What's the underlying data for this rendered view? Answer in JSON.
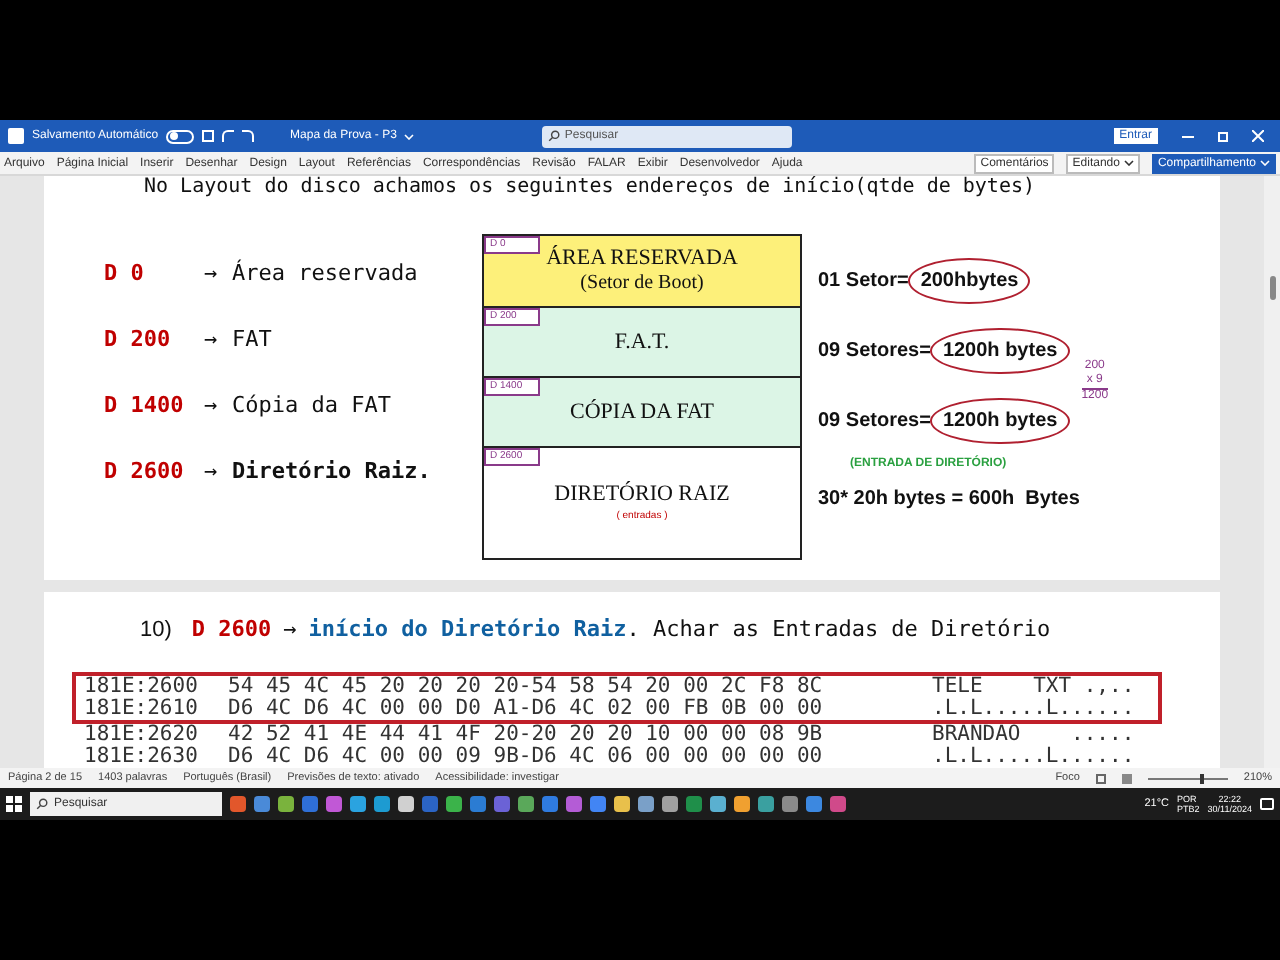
{
  "title_bar": {
    "autosave": {
      "label": "Salvamento Automático",
      "on": false
    },
    "document": "Mapa da Prova - P3",
    "search": {
      "placeholder": "Pesquisar"
    },
    "sign_in": "Entrar"
  },
  "ribbon": {
    "tabs": [
      {
        "label": "Arquivo",
        "selected": false
      },
      {
        "label": "Página Inicial",
        "selected": false
      },
      {
        "label": "Inserir",
        "selected": false
      },
      {
        "label": "Desenhar",
        "selected": false
      },
      {
        "label": "Design",
        "selected": false
      },
      {
        "label": "Layout",
        "selected": false
      },
      {
        "label": "Referências",
        "selected": false
      },
      {
        "label": "Correspondências",
        "selected": false
      },
      {
        "label": "Revisão",
        "selected": false
      },
      {
        "label": "FALAR",
        "selected": false
      },
      {
        "label": "Exibir",
        "selected": false
      },
      {
        "label": "Desenvolvedor",
        "selected": false
      },
      {
        "label": "Ajuda",
        "selected": false
      }
    ],
    "actions": [
      {
        "label": "Comentários",
        "kind": "comments"
      },
      {
        "label": "Editando",
        "kind": "editing"
      },
      {
        "label": "Compartilhamento",
        "kind": "share"
      }
    ]
  },
  "page1": {
    "heading": "No Layout do disco achamos os seguintes endereços de início(qtde de bytes)",
    "layout_list": [
      {
        "address": "D 0",
        "arrow": "→",
        "label": "Área reservada",
        "bold": false
      },
      {
        "address": "D 200",
        "arrow": "→",
        "label": "FAT",
        "bold": false
      },
      {
        "address": "D 1400",
        "arrow": "→",
        "label": "Cópia da FAT",
        "bold": false
      },
      {
        "address": "D 2600",
        "arrow": "→",
        "label": "Diretório Raiz.",
        "bold": true
      }
    ],
    "diagram": {
      "blocks": [
        {
          "tag": "D 0",
          "title": "ÁREA RESERVADA",
          "subtitle": "(Setor de Boot)",
          "color": "#fdf07a"
        },
        {
          "tag": "D 200",
          "title": "F.A.T.",
          "color": "#dcf5e6"
        },
        {
          "tag": "D 1400",
          "title": "CÓPIA DA FAT",
          "color": "#dcf5e6"
        },
        {
          "tag": "D 2600",
          "title": "DIRETÓRIO RAIZ",
          "note": "( entradas )",
          "color": "#ffffff"
        }
      ]
    },
    "notes": [
      {
        "kind": "size",
        "label": "01 Setor=",
        "value": "200hbytes"
      },
      {
        "kind": "size",
        "label": "09 Setores=",
        "value": "1200h bytes",
        "calc": [
          "200",
          "x 9",
          "1200"
        ]
      },
      {
        "kind": "size",
        "label": "09 Setores=",
        "value": "1200h bytes"
      },
      {
        "kind": "caption",
        "text": "(ENTRADA DE DIRETÓRIO)"
      },
      {
        "kind": "formula",
        "text": "30* 20h bytes = 600h  Bytes"
      }
    ]
  },
  "page2": {
    "number": "10)",
    "address": "D 2600",
    "arrow": "→",
    "topic": "início do Diretório Raiz",
    "rest": ". Achar as Entradas de Diretório",
    "dump": [
      {
        "address": "181E:2600",
        "bytes": "54 45 4C 45 20 20 20 20-54 58 54 20 00 2C F8 8C",
        "ascii": "TELE    TXT .,..",
        "highlighted": true
      },
      {
        "address": "181E:2610",
        "bytes": "D6 4C D6 4C 00 00 D0 A1-D6 4C 02 00 FB 0B 00 00",
        "ascii": ".L.L.....L......",
        "highlighted": true
      },
      {
        "address": "181E:2620",
        "bytes": "42 52 41 4E 44 41 4F 20-20 20 20 10 00 00 08 9B",
        "ascii": "BRANDAO    .....",
        "highlighted": false
      },
      {
        "address": "181E:2630",
        "bytes": "D6 4C D6 4C 00 00 09 9B-D6 4C 06 00 00 00 00 00",
        "ascii": ".L.L.....L......",
        "highlighted": false
      }
    ]
  },
  "status_bar": {
    "left": [
      "Página 2 de 15",
      "1403 palavras",
      "Português (Brasil)",
      "Previsões de texto: ativado",
      "Acessibilidade: investigar"
    ],
    "focus": "Foco",
    "zoom": "210%"
  },
  "taskbar": {
    "search": "Pesquisar",
    "weather": "21°C",
    "language": [
      "POR",
      "PTB2"
    ],
    "time": "22:22",
    "date": "30/11/2024"
  }
}
